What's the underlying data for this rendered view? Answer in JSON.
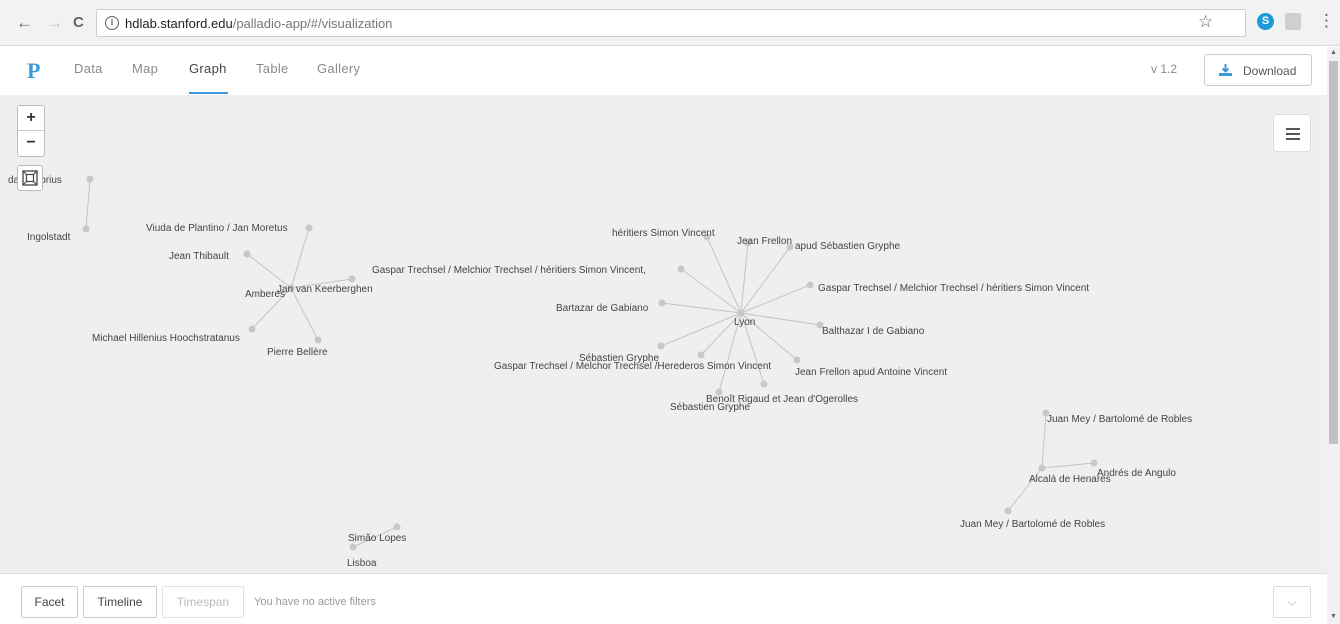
{
  "browser": {
    "back_icon": "←",
    "forward_icon": "→",
    "reload_icon": "C",
    "url_host": "hdlab.stanford.edu",
    "url_path": "/palladio-app/#/visualization",
    "star_icon": "☆",
    "menu_icon": "⋮"
  },
  "app": {
    "logo": "P",
    "tabs": [
      {
        "label": "Data"
      },
      {
        "label": "Map"
      },
      {
        "label": "Graph"
      },
      {
        "label": "Table"
      },
      {
        "label": "Gallery"
      }
    ],
    "active_tab": "Graph",
    "version": "v 1.2",
    "download_label": "Download"
  },
  "graph": {
    "zoom_in": "+",
    "zoom_out": "−",
    "nodes": [
      {
        "id": "n1",
        "label": "Ingolstadt"
      },
      {
        "id": "n2",
        "label": "da Sartorius"
      },
      {
        "id": "n3",
        "label": "Viuda de Plantino / Jan Moretus"
      },
      {
        "id": "n4",
        "label": "Jean Thibault"
      },
      {
        "id": "n5",
        "label": "Amberes"
      },
      {
        "id": "n6",
        "label": "Jan van Keerberghen"
      },
      {
        "id": "n7",
        "label": "Michael Hillenius Hoochstratanus"
      },
      {
        "id": "n8",
        "label": "Pierre Bellère"
      },
      {
        "id": "n9",
        "label": "Gaspar Trechsel / Melchior Trechsel / héritiers Simon Vincent,"
      },
      {
        "id": "n10",
        "label": "héritiers Simon Vincent"
      },
      {
        "id": "n11",
        "label": "Jean Frellon"
      },
      {
        "id": "n12",
        "label": "apud Sébastien Gryphe"
      },
      {
        "id": "n13",
        "label": "Gaspar Trechsel / Melchior Trechsel / héritiers Simon Vincent"
      },
      {
        "id": "n14",
        "label": "Bartazar de Gabiano"
      },
      {
        "id": "n15",
        "label": "Lyon"
      },
      {
        "id": "n16",
        "label": "Balthazar I de Gabiano"
      },
      {
        "id": "n17",
        "label": "Sébastien Gryphe"
      },
      {
        "id": "n18",
        "label": "Gaspar Trechsel / Melchor Trechsel /Herederos Simon Vincent"
      },
      {
        "id": "n19",
        "label": "Jean Frellon apud Antoine Vincent"
      },
      {
        "id": "n20",
        "label": "Benoît Rigaud et Jean d'Ogerolles"
      },
      {
        "id": "n21",
        "label": "Sébastien Gryphe"
      },
      {
        "id": "n22",
        "label": "Juan Mey / Bartolomé de Robles"
      },
      {
        "id": "n23",
        "label": "Alcalá de Henares"
      },
      {
        "id": "n24",
        "label": "Andrés de Angulo"
      },
      {
        "id": "n25",
        "label": "Juan Mey / Bartolomé de Robles"
      },
      {
        "id": "n26",
        "label": "Simão Lopes"
      },
      {
        "id": "n27",
        "label": "Lisboa"
      }
    ]
  },
  "footer": {
    "facet": "Facet",
    "timeline": "Timeline",
    "timespan": "Timespan",
    "no_filters": "You have no active filters"
  }
}
